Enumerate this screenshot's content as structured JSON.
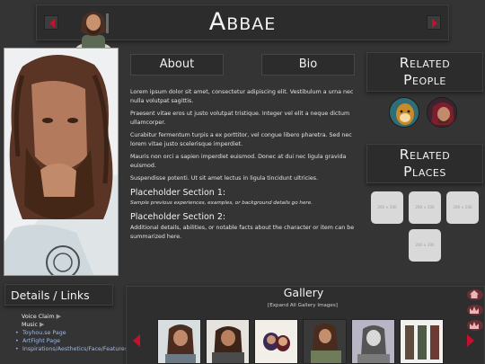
{
  "header": {
    "title": "Abbae"
  },
  "tabs": {
    "about": "About",
    "bio": "Bio"
  },
  "bio": {
    "paragraphs": [
      "Lorem ipsum dolor sit amet, consectetur adipiscing elit. Vestibulum a urna nec nulla volutpat sagittis.",
      "Praesent vitae eros ut justo volutpat tristique. Integer vel elit a neque dictum ullamcorper.",
      "Curabitur fermentum turpis a ex porttitor, vel congue libero pharetra. Sed nec lorem vitae justo scelerisque imperdiet.",
      "Mauris non orci a sapien imperdiet euismod. Donec at dui nec ligula gravida euismod.",
      "Suspendisse potenti. Ut sit amet lectus in ligula tincidunt ultricies."
    ],
    "section1_title": "Placeholder Section 1:",
    "section1_text": "Sample previous experiences, examples, or background details go here.",
    "section2_title": "Placeholder Section 2:",
    "section2_text": "Additional details, abilities, or notable facts about the character or item can be summarized here."
  },
  "related_people": {
    "title_line1": "Related",
    "title_line2": "People"
  },
  "related_places": {
    "title_line1": "Related",
    "title_line2": "Places",
    "placeholder_label": "200 × 200"
  },
  "details": {
    "title": "Details / Links",
    "voice_claim_label": "Voice Claim",
    "music_label": "Music",
    "links": [
      "Toyhou.se Page",
      "ArtFight Page",
      "Inspirations/Aesthetics/Face/Features"
    ]
  },
  "gallery": {
    "title": "Gallery",
    "expand_label": "[Expand All Gallery Images]"
  },
  "colors": {
    "background": "#343434",
    "panel": "#2c2c2c",
    "accent_red": "#c8102e",
    "link": "#9fb8e6"
  },
  "icons": [
    "arrow-left-icon",
    "arrow-right-icon",
    "home-icon",
    "crown-icon",
    "gallery-arrow-left-icon",
    "gallery-arrow-right-icon"
  ]
}
